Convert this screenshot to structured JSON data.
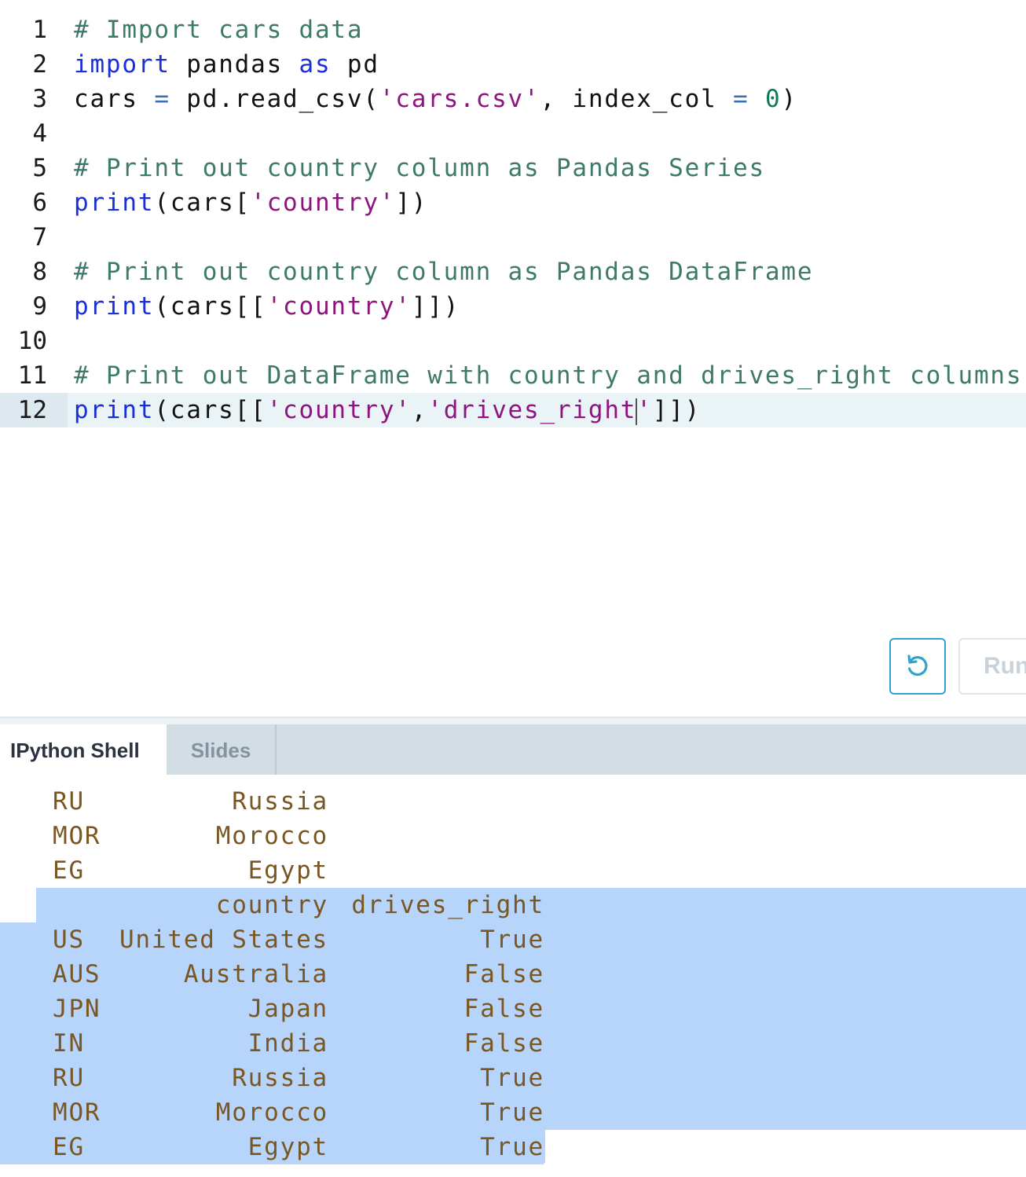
{
  "editor": {
    "lines": [
      {
        "num": "1",
        "tokens": [
          {
            "t": "# Import cars data",
            "c": "cm"
          }
        ]
      },
      {
        "num": "2",
        "tokens": [
          {
            "t": "import",
            "c": "kw"
          },
          {
            "t": " pandas ",
            "c": ""
          },
          {
            "t": "as",
            "c": "kw"
          },
          {
            "t": " pd",
            "c": ""
          }
        ]
      },
      {
        "num": "3",
        "tokens": [
          {
            "t": "cars ",
            "c": ""
          },
          {
            "t": "=",
            "c": "op"
          },
          {
            "t": " pd.read_csv(",
            "c": ""
          },
          {
            "t": "'cars.csv'",
            "c": "st"
          },
          {
            "t": ", index_col ",
            "c": ""
          },
          {
            "t": "=",
            "c": "op"
          },
          {
            "t": " ",
            "c": ""
          },
          {
            "t": "0",
            "c": "nm"
          },
          {
            "t": ")",
            "c": ""
          }
        ]
      },
      {
        "num": "4",
        "tokens": []
      },
      {
        "num": "5",
        "tokens": [
          {
            "t": "# Print out country column as Pandas Series",
            "c": "cm"
          }
        ]
      },
      {
        "num": "6",
        "tokens": [
          {
            "t": "print",
            "c": "kw"
          },
          {
            "t": "(cars[",
            "c": ""
          },
          {
            "t": "'country'",
            "c": "st"
          },
          {
            "t": "])",
            "c": ""
          }
        ]
      },
      {
        "num": "7",
        "tokens": []
      },
      {
        "num": "8",
        "tokens": [
          {
            "t": "# Print out country column as Pandas DataFrame",
            "c": "cm"
          }
        ]
      },
      {
        "num": "9",
        "tokens": [
          {
            "t": "print",
            "c": "kw"
          },
          {
            "t": "(cars[[",
            "c": ""
          },
          {
            "t": "'country'",
            "c": "st"
          },
          {
            "t": "]])",
            "c": ""
          }
        ]
      },
      {
        "num": "10",
        "tokens": []
      },
      {
        "num": "11",
        "tokens": [
          {
            "t": "# Print out DataFrame with country and drives_right columns",
            "c": "cm"
          }
        ]
      },
      {
        "num": "12",
        "active": true,
        "tokens": [
          {
            "t": "print",
            "c": "kw"
          },
          {
            "t": "(cars[[",
            "c": ""
          },
          {
            "t": "'country'",
            "c": "st"
          },
          {
            "t": ",",
            "c": ""
          },
          {
            "t": "'drives_right",
            "c": "st"
          },
          {
            "t": "|",
            "c": "caret"
          },
          {
            "t": "'",
            "c": "st"
          },
          {
            "t": "]])",
            "c": ""
          }
        ]
      }
    ]
  },
  "toolbar": {
    "reset_icon": "reset-icon",
    "run_label": "Run"
  },
  "tabs": [
    {
      "label": "IPython Shell",
      "active": true
    },
    {
      "label": "Slides",
      "active": false
    }
  ],
  "console": {
    "rows": [
      {
        "idx": "RU",
        "country": "Russia",
        "drives": ""
      },
      {
        "idx": "MOR",
        "country": "Morocco",
        "drives": ""
      },
      {
        "idx": "EG",
        "country": "Egypt",
        "drives": ""
      },
      {
        "idx": "",
        "country": "country",
        "drives": "drives_right"
      },
      {
        "idx": "US",
        "country": "United States",
        "drives": "True"
      },
      {
        "idx": "AUS",
        "country": "Australia",
        "drives": "False"
      },
      {
        "idx": "JPN",
        "country": "Japan",
        "drives": "False"
      },
      {
        "idx": "IN",
        "country": "India",
        "drives": "False"
      },
      {
        "idx": "RU",
        "country": "Russia",
        "drives": "True"
      },
      {
        "idx": "MOR",
        "country": "Morocco",
        "drives": "True"
      },
      {
        "idx": "EG",
        "country": "Egypt",
        "drives": "True"
      }
    ]
  },
  "colors": {
    "comment": "#3d7a6a",
    "keyword": "#1a2fd6",
    "string": "#8f147f",
    "output": "#7a5621",
    "selection": "#b7d4fb",
    "accent": "#33a3c9"
  }
}
